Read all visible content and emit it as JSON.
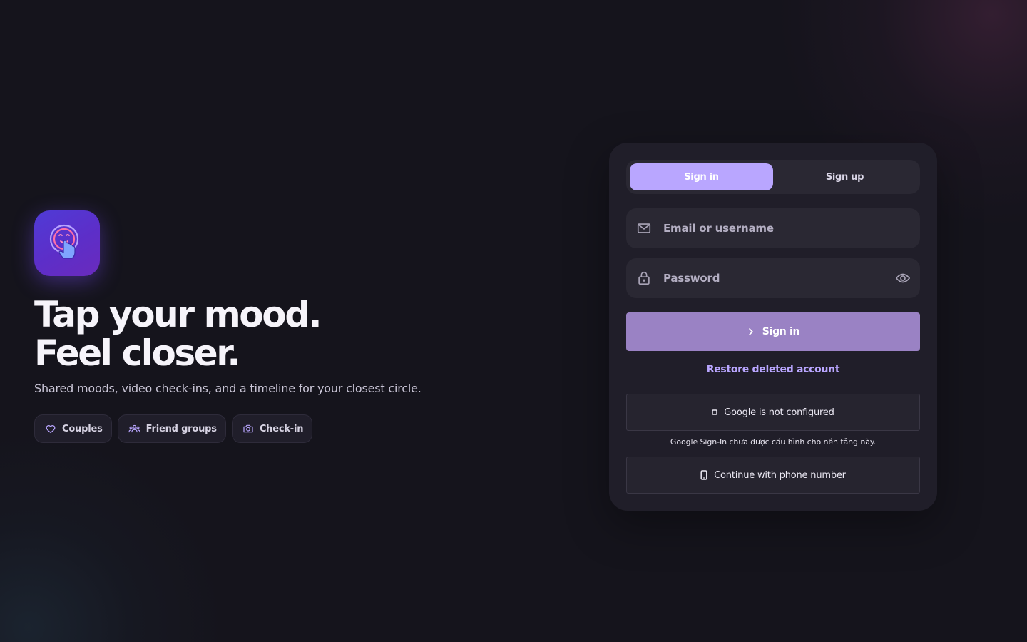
{
  "hero": {
    "title_line1": "Tap your mood.",
    "title_line2": "Feel closer.",
    "subtitle": "Shared moods, video check-ins, and a timeline for your closest circle.",
    "chips": [
      {
        "label": "Couples",
        "icon": "heart-icon"
      },
      {
        "label": "Friend groups",
        "icon": "users-icon"
      },
      {
        "label": "Check-in",
        "icon": "camera-icon"
      }
    ],
    "app_icon": "tap-mood-app-icon"
  },
  "auth": {
    "tabs": [
      {
        "label": "Sign in",
        "active": true
      },
      {
        "label": "Sign up",
        "active": false
      }
    ],
    "email_placeholder": "Email or username",
    "password_placeholder": "Password",
    "submit_label": "Sign in",
    "restore_label": "Restore deleted account",
    "google_label": "Google is not configured",
    "google_note": "Google Sign-In chưa được cấu hình cho nền tảng này.",
    "phone_label": "Continue with phone number"
  },
  "colors": {
    "background": "#15141c",
    "card": "#201e29",
    "accent": "#b9a6ff",
    "submit": "#9a82c4"
  }
}
